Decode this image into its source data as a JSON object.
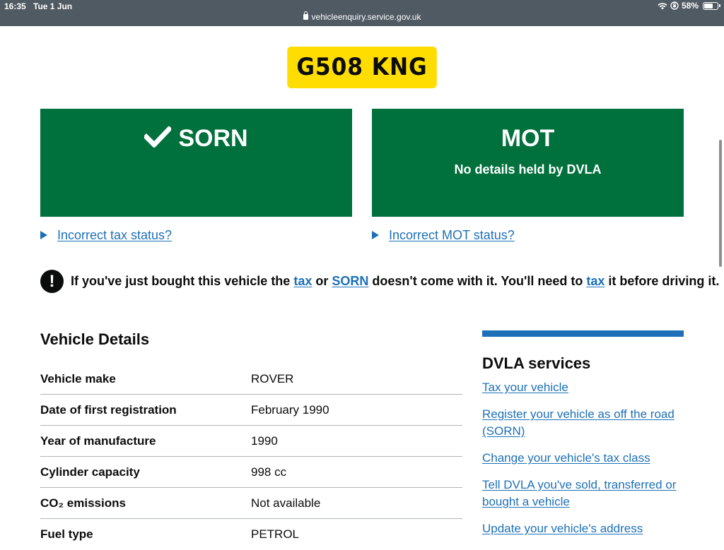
{
  "statusBar": {
    "time": "16:35",
    "date": "Tue 1 Jun",
    "battery": "58%",
    "battery_level": 0.58,
    "url": "vehicleenquiry.service.gov.uk"
  },
  "registration": "G508 KNG",
  "tax": {
    "status": "SORN",
    "toggle_label": "Incorrect tax status?"
  },
  "mot": {
    "status": "MOT",
    "detail": "No details held by DVLA",
    "toggle_label": "Incorrect MOT status?"
  },
  "warning": {
    "icon": "!",
    "part1": "If you've just bought this vehicle the",
    "link_tax": "tax",
    "part2": "or",
    "link_sorn": "SORN",
    "part3": "doesn't come with it. You'll need to",
    "link_tax2": "tax",
    "part4": "it before driving it."
  },
  "details": {
    "heading": "Vehicle Details",
    "rows": [
      {
        "key": "Vehicle make",
        "value": "ROVER"
      },
      {
        "key": "Date of first registration",
        "value": "February 1990"
      },
      {
        "key": "Year of manufacture",
        "value": "1990"
      },
      {
        "key": "Cylinder capacity",
        "value": "998 cc"
      },
      {
        "key": "CO₂ emissions",
        "value": "Not available"
      },
      {
        "key": "Fuel type",
        "value": "PETROL"
      }
    ]
  },
  "services": {
    "heading": "DVLA services",
    "links": [
      "Tax your vehicle",
      "Register your vehicle as off the road (SORN)",
      "Change your vehicle's tax class",
      "Tell DVLA you've sold, transferred or bought a vehicle",
      "Update your vehicle's address"
    ]
  },
  "colors": {
    "status_bar": "#505a63",
    "plate": "#ffdd00",
    "panel_green": "#00703c",
    "link_blue": "#1d70b8",
    "text": "#0b0c0c"
  }
}
